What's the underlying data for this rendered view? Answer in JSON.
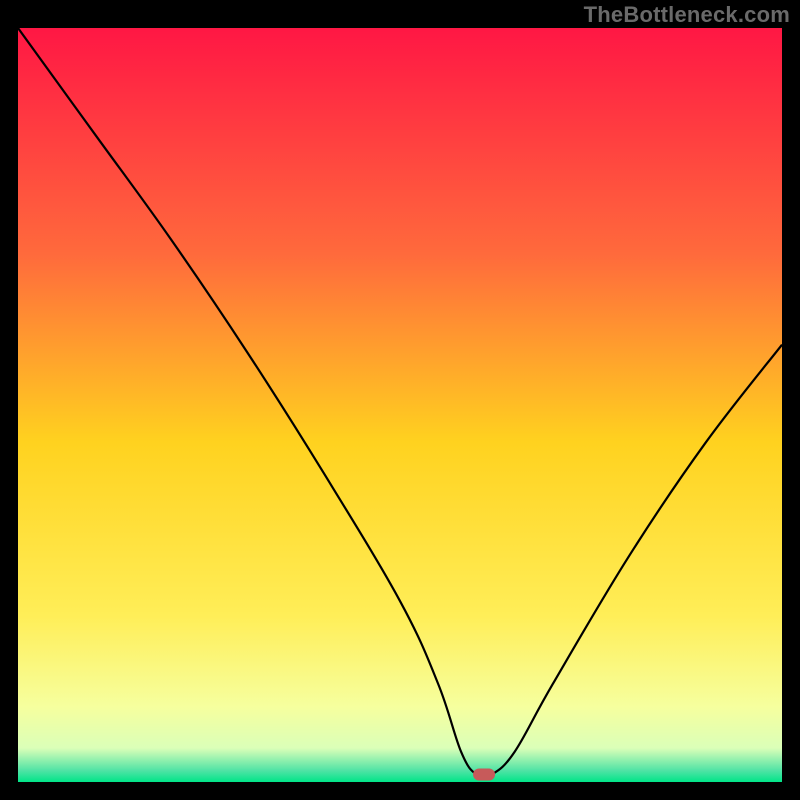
{
  "watermark": "TheBottleneck.com",
  "chart_data": {
    "type": "line",
    "title": "",
    "xlabel": "",
    "ylabel": "",
    "xlim": [
      0,
      100
    ],
    "ylim": [
      0,
      100
    ],
    "grid": false,
    "legend": false,
    "series": [
      {
        "name": "bottleneck-curve",
        "x": [
          0,
          10,
          20,
          30,
          40,
          50,
          55,
          58,
          60,
          62,
          65,
          70,
          80,
          90,
          100
        ],
        "values": [
          100,
          86,
          72,
          57,
          41,
          24,
          13,
          4,
          1,
          1,
          4,
          13,
          30,
          45,
          58
        ]
      }
    ],
    "marker": {
      "name": "optimal-point",
      "x": 61,
      "y": 1,
      "color": "#c75a5a",
      "shape": "pill"
    },
    "gradient": {
      "stops": [
        {
          "offset": 0,
          "color": "#ff1744"
        },
        {
          "offset": 0.3,
          "color": "#ff6a3c"
        },
        {
          "offset": 0.55,
          "color": "#ffd21f"
        },
        {
          "offset": 0.78,
          "color": "#ffee58"
        },
        {
          "offset": 0.9,
          "color": "#f6ff9e"
        },
        {
          "offset": 0.955,
          "color": "#dbffb8"
        },
        {
          "offset": 0.985,
          "color": "#4fe3a5"
        },
        {
          "offset": 1.0,
          "color": "#00e588"
        }
      ]
    }
  }
}
